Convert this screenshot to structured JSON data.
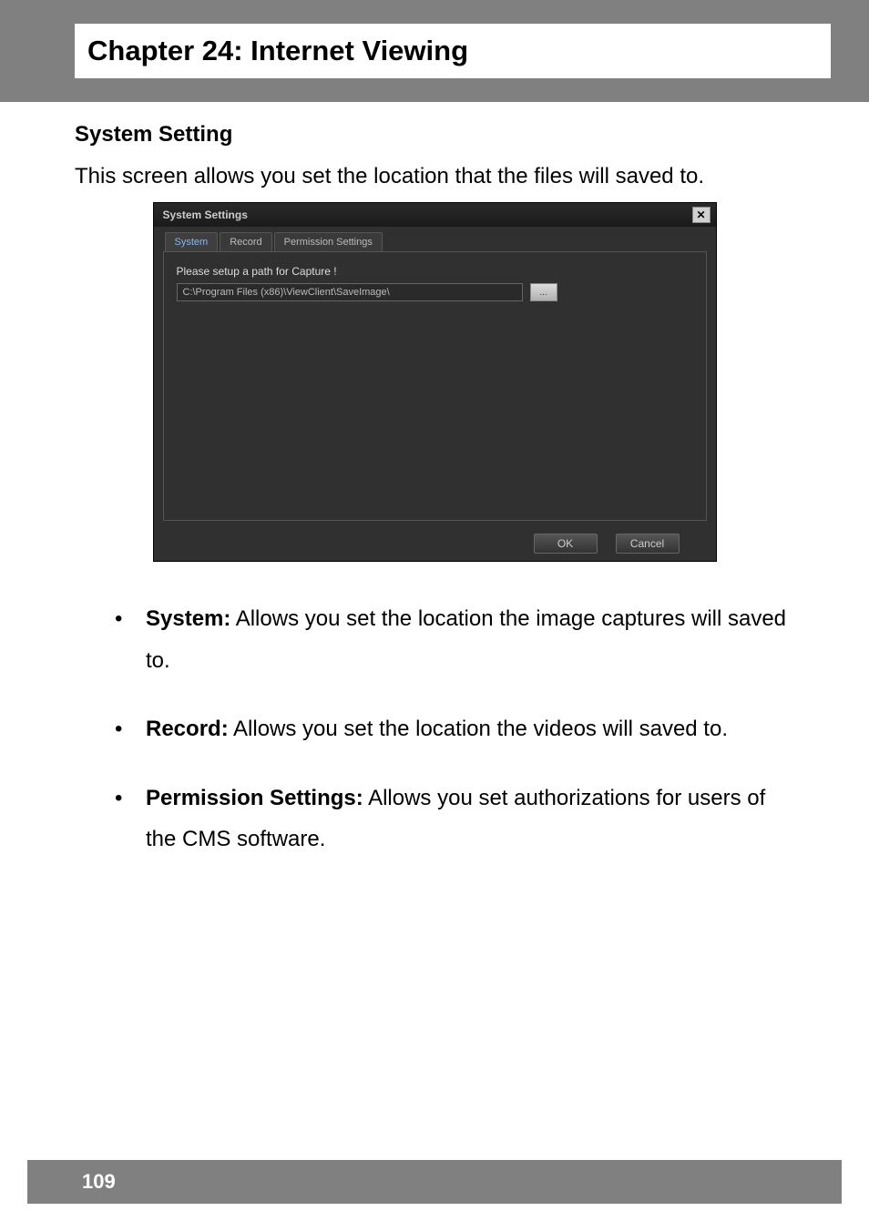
{
  "chapter": {
    "title": "Chapter 24: Internet Viewing"
  },
  "section": {
    "title": "System Setting",
    "intro": "This screen allows you set the location that the files will saved to."
  },
  "dialog": {
    "title": "System Settings",
    "close_glyph": "✕",
    "tabs": {
      "system": "System",
      "record": "Record",
      "permission": "Permission Settings"
    },
    "panel": {
      "setup_label": "Please setup a path for Capture !",
      "path_value": "C:\\Program Files (x86)\\ViewClient\\SaveImage\\",
      "browse_label": "..."
    },
    "buttons": {
      "ok": "OK",
      "cancel": "Cancel"
    }
  },
  "bullets": {
    "system": {
      "term": "System:",
      "desc": " Allows you set the location the image captures will saved to."
    },
    "record": {
      "term": "Record:",
      "desc": " Allows you set the location the videos will saved to."
    },
    "permission": {
      "term": "Permission Settings:",
      "desc": " Allows you set authorizations for users of the CMS software."
    }
  },
  "footer": {
    "page_number": "109"
  }
}
